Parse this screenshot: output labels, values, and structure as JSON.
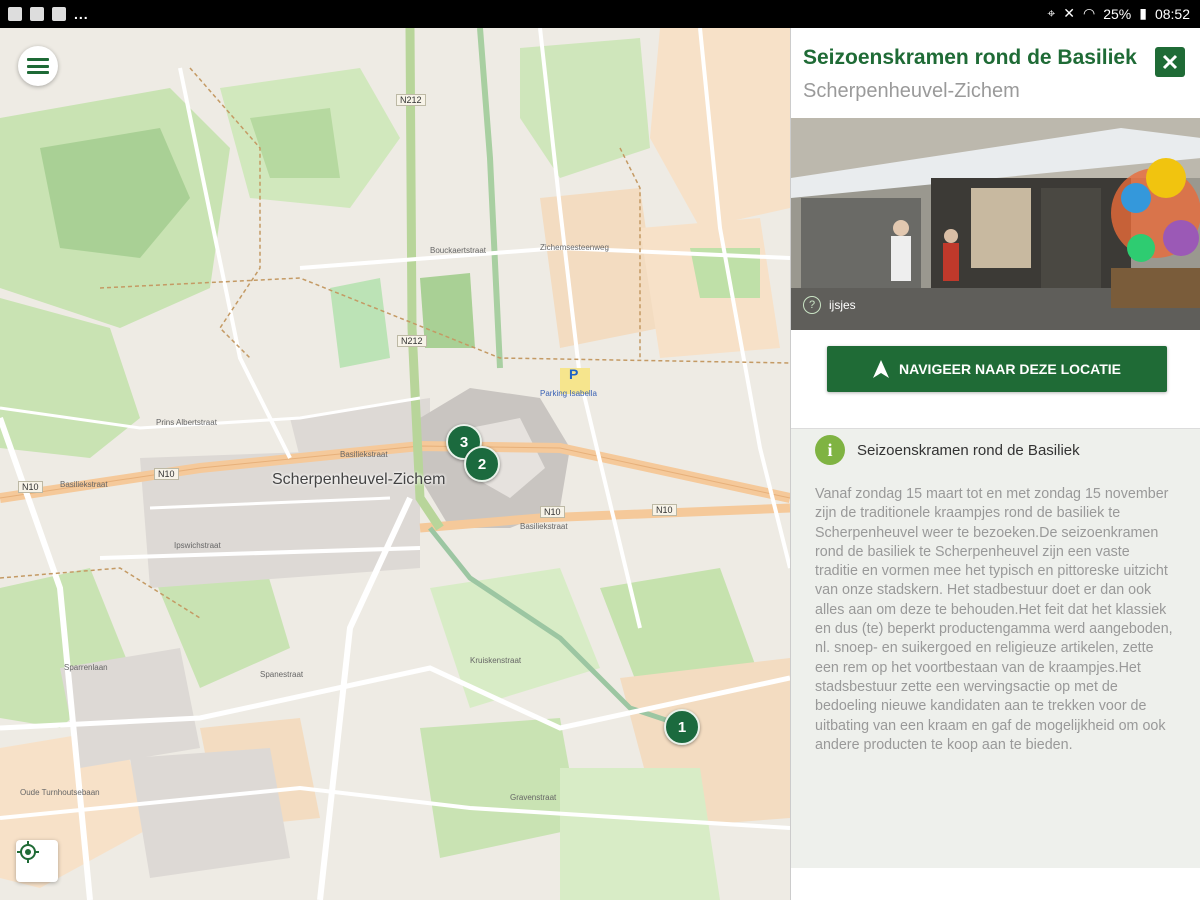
{
  "statusbar": {
    "battery": "25%",
    "time": "08:52",
    "more": "..."
  },
  "map": {
    "town_label": "Scherpenheuvel-Zichem",
    "markers": [
      {
        "label": "3"
      },
      {
        "label": "2"
      },
      {
        "label": "1"
      }
    ],
    "road_tags": [
      "N212",
      "N212",
      "N10",
      "N10",
      "N10",
      "N10"
    ],
    "streets": [
      "Basiliekstraat",
      "Basiliekstraat",
      "Basiliekstraat",
      "Zichemsesteenweg",
      "Prins Albertstraat",
      "Spanestraat",
      "Bouckaertstraat",
      "Gravenstraat",
      "Ipswichstraat",
      "Sparrenlaan",
      "Oude Turnhoutsebaan",
      "Kruiskenstraat"
    ],
    "parking_label": "Parking Isabella"
  },
  "panel": {
    "title": "Seizoenskramen rond de Basiliek",
    "subtitle": "Scherpenheuvel-Zichem",
    "photo_caption": "ijsjes",
    "navigate_button": "NAVIGEER NAAR DEZE LOCATIE",
    "info_title": "Seizoenskramen rond de Basiliek",
    "info_text": "Vanaf zondag 15 maart tot en met zondag 15 november zijn de traditionele kraampjes rond de basiliek te Scherpenheuvel weer te bezoeken.De seizoenkramen rond de basiliek te Scherpenheuvel zijn een vaste traditie en vormen mee het typisch en pittoreske uitzicht van onze stadskern. Het stadbestuur doet er dan ook alles aan om deze te behouden.Het feit dat het klassiek en dus (te) beperkt productengamma werd aangeboden, nl. snoep- en suikergoed en religieuze artikelen, zette een rem op het voortbestaan van de kraampjes.Het stadsbestuur zette een wervingsactie op met de bedoeling nieuwe kandidaten aan te trekken voor de uitbating van een kraam en gaf de mogelijkheid om ook andere producten te koop aan te bieden."
  },
  "colors": {
    "brand_green": "#1f6b36",
    "marker_green": "#1b6a3e",
    "info_green": "#7fb342",
    "panel_bg": "#eef0ec"
  },
  "icons": {
    "menu": "hamburger-icon",
    "locate": "crosshair-icon",
    "close": "close-icon",
    "navigate": "navigation-arrow-icon",
    "info": "info-icon",
    "help": "question-icon"
  }
}
